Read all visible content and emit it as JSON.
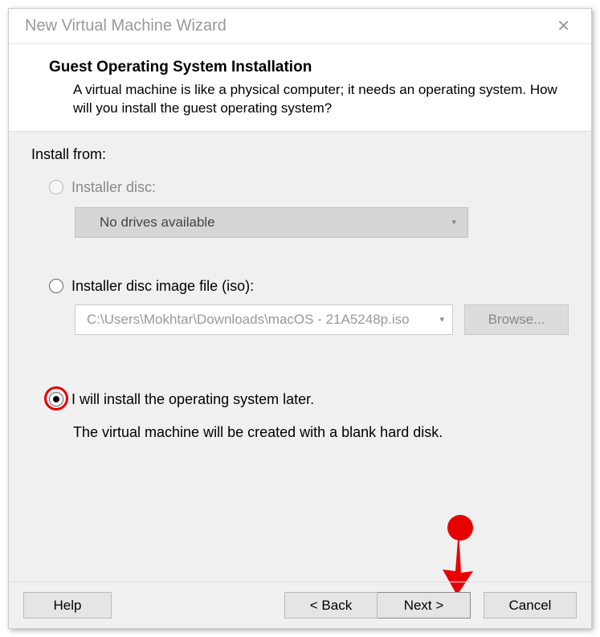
{
  "titlebar": {
    "title": "New Virtual Machine Wizard"
  },
  "header": {
    "title": "Guest Operating System Installation",
    "description": "A virtual machine is like a physical computer; it needs an operating system. How will you install the guest operating system?"
  },
  "content": {
    "install_from": "Install from:",
    "option1": {
      "label": "Installer disc:",
      "dropdown": "No drives available"
    },
    "option2": {
      "label": "Installer disc image file (iso):",
      "path": "C:\\Users\\Mokhtar\\Downloads\\macOS - 21A5248p.iso",
      "browse": "Browse..."
    },
    "option3": {
      "label": "I will install the operating system later.",
      "sub": "The virtual machine will be created with a blank hard disk."
    }
  },
  "buttons": {
    "help": "Help",
    "back": "< Back",
    "next": "Next >",
    "cancel": "Cancel"
  }
}
